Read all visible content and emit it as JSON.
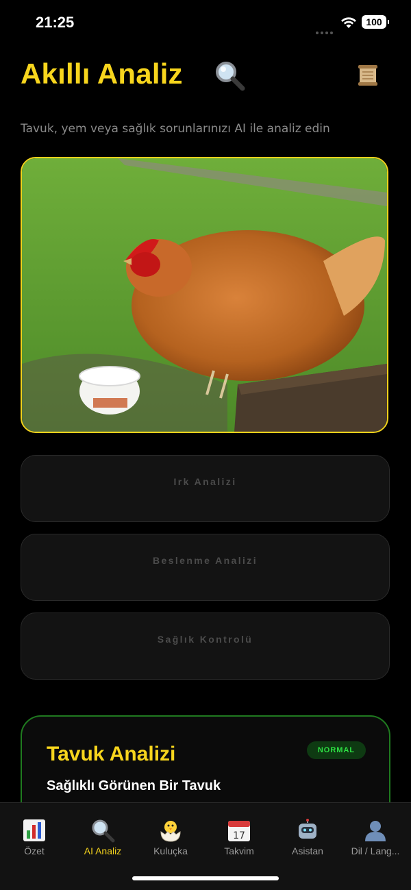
{
  "status_bar": {
    "time": "21:25",
    "battery": "100"
  },
  "header": {
    "title": "Akıllı Analiz",
    "title_icon": "magnifier-icon",
    "action_icon": "scroll-icon",
    "subtitle": "Tavuk, yem veya sağlık sorunlarınızı AI ile analiz edin"
  },
  "photo": {
    "subject": "chicken-photo"
  },
  "analysis_buttons": [
    {
      "label": "Irk Analizi"
    },
    {
      "label": "Beslenme Analizi"
    },
    {
      "label": "Sağlık Kontrolü"
    }
  ],
  "result": {
    "title": "Tavuk Analizi",
    "badge": "NORMAL",
    "subtitle": "Sağlıklı Görünen Bir Tavuk"
  },
  "tab_bar": {
    "active_index": 1,
    "items": [
      {
        "label": "Özet",
        "icon": "bar-chart-icon"
      },
      {
        "label": "AI Analiz",
        "icon": "magnifier-icon"
      },
      {
        "label": "Kuluçka",
        "icon": "hatching-chick-icon"
      },
      {
        "label": "Takvim",
        "icon": "calendar-icon"
      },
      {
        "label": "Asistan",
        "icon": "robot-icon"
      },
      {
        "label": "Dil / Lang...",
        "icon": "user-icon"
      }
    ]
  },
  "colors": {
    "accent": "#f7d51d",
    "success": "#2ee244",
    "card_border_green": "#1f7a1f"
  }
}
